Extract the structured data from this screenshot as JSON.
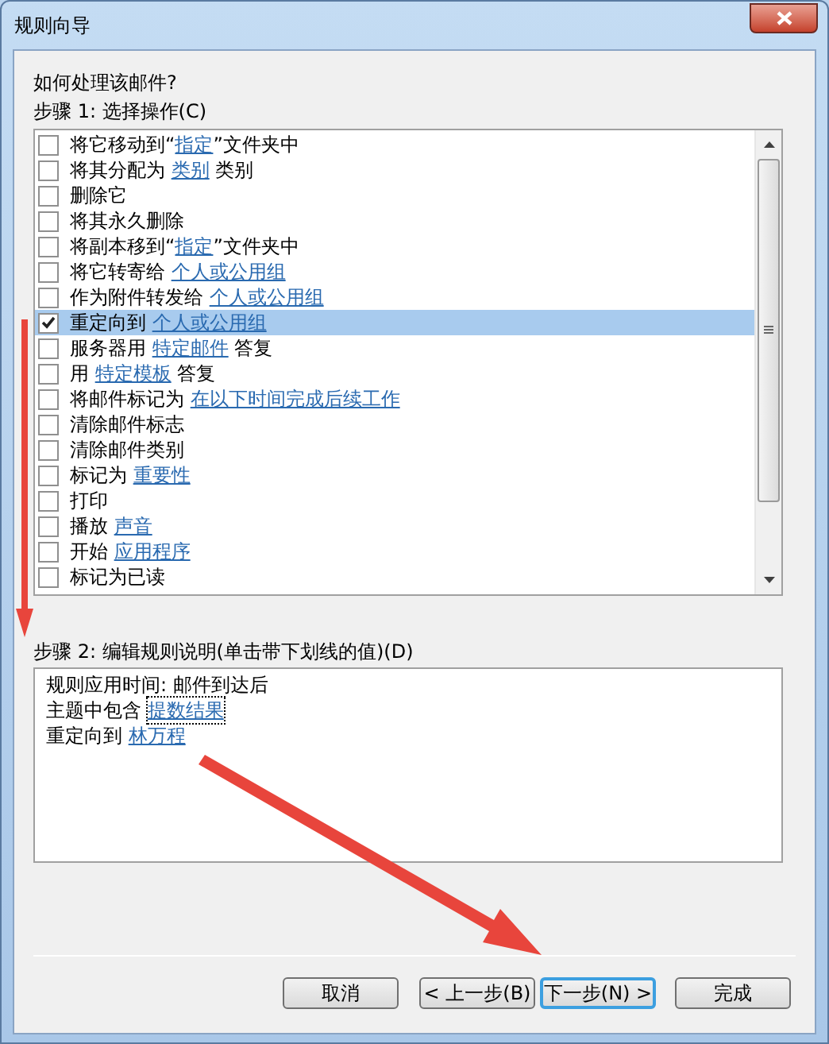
{
  "window": {
    "title": "规则向导"
  },
  "question": "如何处理该邮件?",
  "step1": {
    "label": "步骤 1: 选择操作(C)",
    "actions": [
      {
        "checked": false,
        "selected": false,
        "parts": [
          {
            "kind": "text",
            "text": "将它移动到“"
          },
          {
            "kind": "link",
            "text": "指定"
          },
          {
            "kind": "text",
            "text": "”文件夹中"
          }
        ]
      },
      {
        "checked": false,
        "selected": false,
        "parts": [
          {
            "kind": "text",
            "text": "将其分配为 "
          },
          {
            "kind": "link",
            "text": "类别"
          },
          {
            "kind": "text",
            "text": " 类别"
          }
        ]
      },
      {
        "checked": false,
        "selected": false,
        "parts": [
          {
            "kind": "text",
            "text": "删除它"
          }
        ]
      },
      {
        "checked": false,
        "selected": false,
        "parts": [
          {
            "kind": "text",
            "text": "将其永久删除"
          }
        ]
      },
      {
        "checked": false,
        "selected": false,
        "parts": [
          {
            "kind": "text",
            "text": "将副本移到“"
          },
          {
            "kind": "link",
            "text": "指定"
          },
          {
            "kind": "text",
            "text": "”文件夹中"
          }
        ]
      },
      {
        "checked": false,
        "selected": false,
        "parts": [
          {
            "kind": "text",
            "text": "将它转寄给 "
          },
          {
            "kind": "link",
            "text": "个人或公用组"
          }
        ]
      },
      {
        "checked": false,
        "selected": false,
        "parts": [
          {
            "kind": "text",
            "text": "作为附件转发给 "
          },
          {
            "kind": "link",
            "text": "个人或公用组"
          }
        ]
      },
      {
        "checked": true,
        "selected": true,
        "parts": [
          {
            "kind": "text",
            "text": "重定向到 "
          },
          {
            "kind": "link",
            "text": "个人或公用组"
          }
        ]
      },
      {
        "checked": false,
        "selected": false,
        "parts": [
          {
            "kind": "text",
            "text": "服务器用 "
          },
          {
            "kind": "link",
            "text": "特定邮件"
          },
          {
            "kind": "text",
            "text": " 答复"
          }
        ]
      },
      {
        "checked": false,
        "selected": false,
        "parts": [
          {
            "kind": "text",
            "text": "用 "
          },
          {
            "kind": "link",
            "text": "特定模板"
          },
          {
            "kind": "text",
            "text": " 答复"
          }
        ]
      },
      {
        "checked": false,
        "selected": false,
        "parts": [
          {
            "kind": "text",
            "text": "将邮件标记为 "
          },
          {
            "kind": "link",
            "text": "在以下时间完成后续工作"
          }
        ]
      },
      {
        "checked": false,
        "selected": false,
        "parts": [
          {
            "kind": "text",
            "text": "清除邮件标志"
          }
        ]
      },
      {
        "checked": false,
        "selected": false,
        "parts": [
          {
            "kind": "text",
            "text": "清除邮件类别"
          }
        ]
      },
      {
        "checked": false,
        "selected": false,
        "parts": [
          {
            "kind": "text",
            "text": "标记为 "
          },
          {
            "kind": "link",
            "text": "重要性"
          }
        ]
      },
      {
        "checked": false,
        "selected": false,
        "parts": [
          {
            "kind": "text",
            "text": "打印"
          }
        ]
      },
      {
        "checked": false,
        "selected": false,
        "parts": [
          {
            "kind": "text",
            "text": "播放 "
          },
          {
            "kind": "link",
            "text": "声音"
          }
        ]
      },
      {
        "checked": false,
        "selected": false,
        "parts": [
          {
            "kind": "text",
            "text": "开始 "
          },
          {
            "kind": "link",
            "text": "应用程序"
          }
        ]
      },
      {
        "checked": false,
        "selected": false,
        "parts": [
          {
            "kind": "text",
            "text": "标记为已读"
          }
        ]
      }
    ]
  },
  "step2": {
    "label": "步骤 2: 编辑规则说明(单击带下划线的值)(D)",
    "lines": [
      {
        "parts": [
          {
            "kind": "text",
            "text": "规则应用时间: 邮件到达后"
          }
        ]
      },
      {
        "parts": [
          {
            "kind": "text",
            "text": "主题中包含 "
          },
          {
            "kind": "link",
            "text": "提数结果",
            "focused": true
          }
        ]
      },
      {
        "parts": [
          {
            "kind": "text",
            "text": "重定向到 "
          },
          {
            "kind": "link",
            "text": "林万程",
            "focused": false
          }
        ]
      }
    ]
  },
  "buttons": [
    {
      "label": "取消",
      "default": false
    },
    {
      "label": "< 上一步(B)",
      "default": false
    },
    {
      "label": "下一步(N) >",
      "default": true
    },
    {
      "label": "完成",
      "default": false
    }
  ]
}
